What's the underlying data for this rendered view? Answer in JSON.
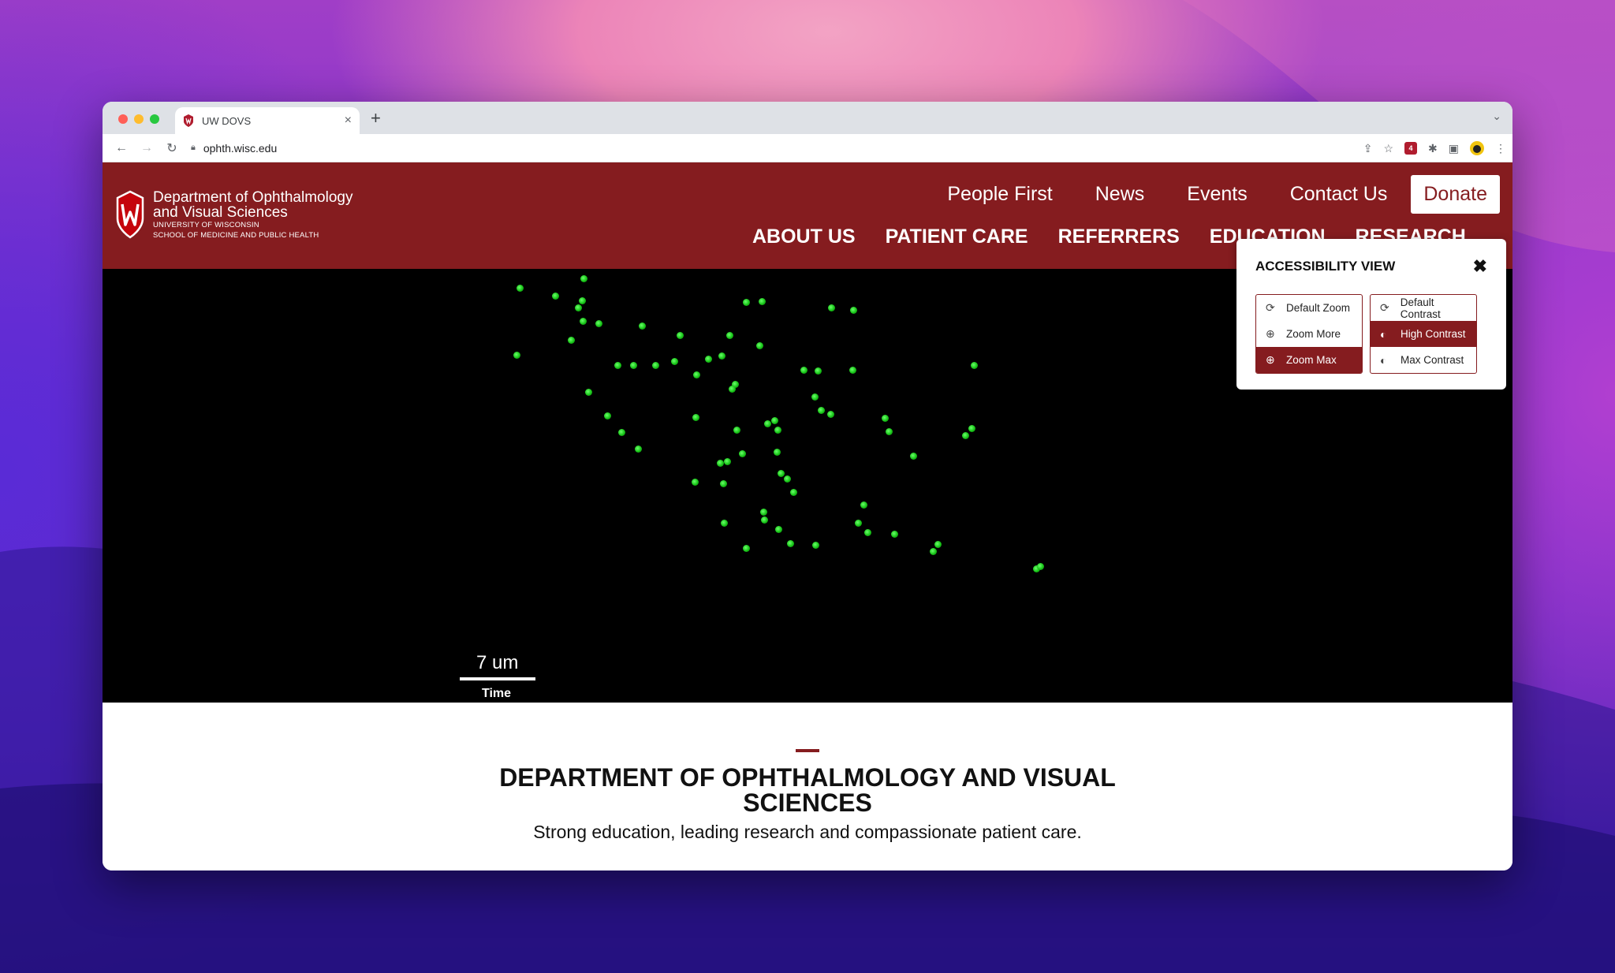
{
  "browser": {
    "tab_title": "UW DOVS",
    "new_tab": "+",
    "tab_close": "×",
    "address": "ophth.wisc.edu",
    "extension_badge": "4"
  },
  "site": {
    "logo": {
      "line1": "Department of Ophthalmology",
      "line2": "and Visual Sciences",
      "line3": "UNIVERSITY OF WISCONSIN",
      "line4": "SCHOOL OF MEDICINE AND PUBLIC HEALTH"
    },
    "top_nav": [
      "People First",
      "News",
      "Events",
      "Contact Us"
    ],
    "donate": "Donate",
    "main_nav": [
      "ABOUT US",
      "PATIENT CARE",
      "REFERRERS",
      "EDUCATION",
      "RESEARCH"
    ]
  },
  "hero": {
    "scale_label": "7 um",
    "time_label": "Time"
  },
  "accessibility": {
    "title": "ACCESSIBILITY VIEW",
    "zoom": [
      {
        "label": "Default Zoom",
        "icon": "refresh-icon",
        "active": false
      },
      {
        "label": "Zoom More",
        "icon": "zoom-in-icon",
        "active": false
      },
      {
        "label": "Zoom Max",
        "icon": "zoom-in-icon",
        "active": true
      }
    ],
    "contrast": [
      {
        "label": "Default Contrast",
        "icon": "refresh-icon",
        "active": false
      },
      {
        "label": "High Contrast",
        "icon": "contrast-icon",
        "active": true
      },
      {
        "label": "Max Contrast",
        "icon": "contrast-icon",
        "active": false
      }
    ]
  },
  "content": {
    "heading": "DEPARTMENT OF OPHTHALMOLOGY AND VISUAL SCIENCES",
    "tagline": "Strong education, leading research and compassionate patient care."
  },
  "colors": {
    "brand": "#851c1f",
    "dot": "#17c417"
  }
}
